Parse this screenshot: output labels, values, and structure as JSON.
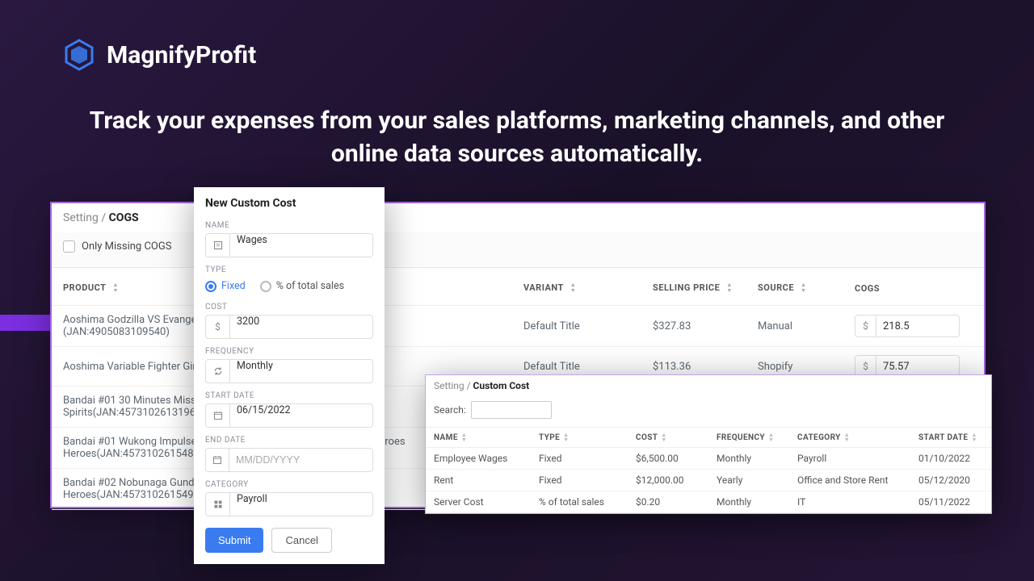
{
  "brand": "MagnifyProfit",
  "tagline": "Track your expenses from your sales platforms, marketing channels, and other online data sources automatically.",
  "cogs_panel": {
    "breadcrumb_parent": "Setting",
    "breadcrumb_current": "COGS",
    "checkbox_label": "Only Missing COGS",
    "columns": {
      "product": "Product",
      "variant": "Variant",
      "selling_price": "Selling Price",
      "source": "Source",
      "cogs": "COGS"
    },
    "rows": [
      {
        "product_top": "Aoshima Godzilla VS Evangelion Type-3 Kiryu EVA-01 Color Ver.)",
        "product_sub": "(JAN:4905083109540)",
        "variant": "Default Title",
        "selling_price": "$327.83",
        "source": "Manual",
        "cogs": "218.5"
      },
      {
        "product_top": "Aoshima Variable Fighter Girls Macross Delta (JAN:4905083061800)",
        "product_sub": "",
        "variant": "Default Title",
        "selling_price": "$113.36",
        "source": "Shopify",
        "cogs": "75.57"
      },
      {
        "product_top": "Bandai #01 30 Minutes Missions '30 Minute Missions', Bandai Spirits",
        "product_sub": "Spirits(JAN:4573102613196)",
        "variant": "",
        "selling_price": "",
        "source": "",
        "cogs": ""
      },
      {
        "product_top": "Bandai #01 Wukong Impulse Gundam 'SD Gundam', Bandai Spirits Heroes",
        "product_sub": "Heroes(JAN:4573102615480)",
        "variant": "",
        "selling_price": "",
        "source": "",
        "cogs": ""
      },
      {
        "product_top": "Bandai #02 Nobunaga Gundam Epyon 'SD', Bandai Spirits Heroes",
        "product_sub": "Heroes(JAN:4573102615497)",
        "variant": "",
        "selling_price": "",
        "source": "",
        "cogs": ""
      }
    ]
  },
  "modal": {
    "title": "New Custom Cost",
    "labels": {
      "name": "Name",
      "type": "Type",
      "cost": "Cost",
      "frequency": "Frequency",
      "start_date": "Start Date",
      "end_date": "End Date",
      "category": "Category"
    },
    "values": {
      "name": "Wages",
      "type_fixed": "Fixed",
      "type_pct": "% of total sales",
      "cost": "3200",
      "frequency": "Monthly",
      "start_date": "06/15/2022",
      "end_date_placeholder": "MM/DD/YYYY",
      "category": "Payroll"
    },
    "buttons": {
      "submit": "Submit",
      "cancel": "Cancel"
    }
  },
  "cc_panel": {
    "breadcrumb_parent": "Setting",
    "breadcrumb_current": "Custom Cost",
    "search_label": "Search:",
    "columns": {
      "name": "Name",
      "type": "Type",
      "cost": "Cost",
      "frequency": "Frequency",
      "category": "Category",
      "start_date": "Start Date"
    },
    "rows": [
      {
        "name": "Employee Wages",
        "type": "Fixed",
        "cost": "$6,500.00",
        "frequency": "Monthly",
        "category": "Payroll",
        "start_date": "01/10/2022"
      },
      {
        "name": "Rent",
        "type": "Fixed",
        "cost": "$12,000.00",
        "frequency": "Yearly",
        "category": "Office and Store Rent",
        "start_date": "05/12/2020"
      },
      {
        "name": "Server Cost",
        "type": "% of total sales",
        "cost": "$0.20",
        "frequency": "Monthly",
        "category": "IT",
        "start_date": "05/11/2022"
      }
    ]
  }
}
